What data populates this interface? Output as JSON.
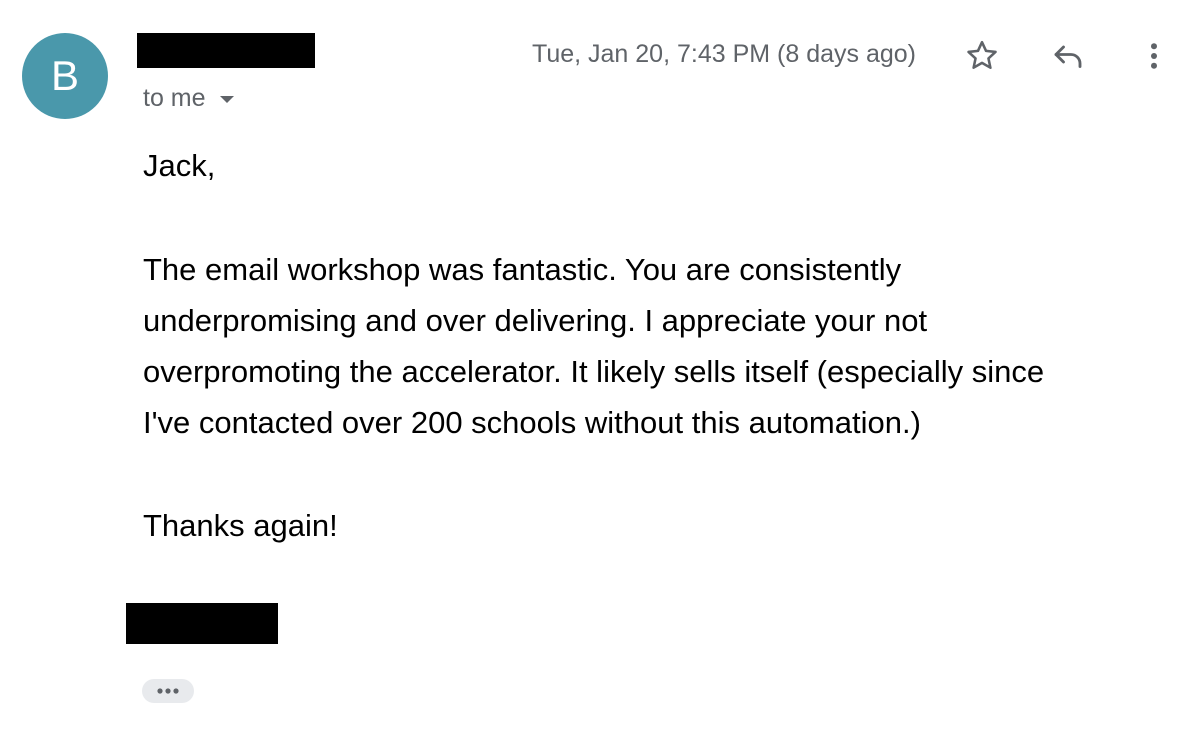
{
  "sender": {
    "avatar_letter": "B",
    "avatar_color": "#4a98ab"
  },
  "header": {
    "recipient_label": "to me",
    "timestamp": "Tue, Jan 20, 7:43 PM (8 days ago)"
  },
  "icons": {
    "star": "star-icon",
    "reply": "reply-icon",
    "more": "more-vertical-icon",
    "chevron": "chevron-down-icon",
    "trimmed": "more-horizontal-icon"
  },
  "message": {
    "greeting": "Jack,",
    "paragraph": "The email workshop was fantastic.  You are consistently\nunderpromising and over delivering.  I appreciate your not\noverpromoting the accelerator.  It likely sells itself (especially since\nI've contacted over 200 schools without this automation.)",
    "closing": "Thanks again!"
  }
}
